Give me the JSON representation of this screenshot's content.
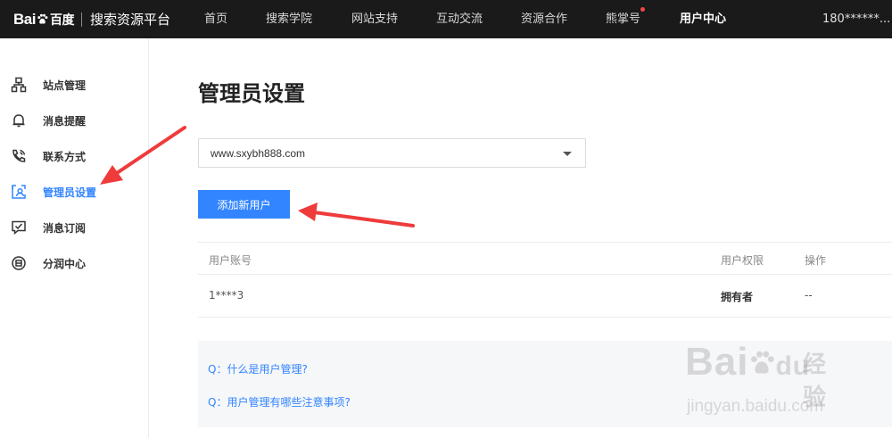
{
  "header": {
    "logo_brand": "Bai",
    "logo_brand_suffix": "百度",
    "platform": "搜索资源平台",
    "nav": [
      {
        "label": "首页"
      },
      {
        "label": "搜索学院"
      },
      {
        "label": "网站支持"
      },
      {
        "label": "互动交流"
      },
      {
        "label": "资源合作"
      },
      {
        "label": "熊掌号"
      },
      {
        "label": "用户中心"
      }
    ],
    "account": "180******..."
  },
  "sidebar": {
    "items": [
      {
        "label": "站点管理",
        "icon": "sitemap-icon"
      },
      {
        "label": "消息提醒",
        "icon": "bell-icon"
      },
      {
        "label": "联系方式",
        "icon": "phone-icon"
      },
      {
        "label": "管理员设置",
        "icon": "admin-user-icon"
      },
      {
        "label": "消息订阅",
        "icon": "subscribe-icon"
      },
      {
        "label": "分润中心",
        "icon": "profit-share-icon"
      }
    ],
    "active_index": 3
  },
  "main": {
    "title": "管理员设置",
    "site_select": {
      "value": "www.sxybh888.com"
    },
    "add_user_label": "添加新用户",
    "table": {
      "headers": [
        "用户账号",
        "用户权限",
        "操作"
      ],
      "rows": [
        [
          "1****3",
          "拥有者",
          "--"
        ]
      ]
    },
    "faq": [
      {
        "text": "Q：什么是用户管理?"
      },
      {
        "text": "Q：用户管理有哪些注意事项?"
      }
    ]
  },
  "watermark": {
    "brand_left": "Bai",
    "brand_right": "du",
    "brand_cn": "经验",
    "url": "jingyan.baidu.com"
  },
  "colors": {
    "accent": "#3385ff",
    "topbar": "#1a1a1a",
    "annotation_arrow": "#ef3b3b",
    "notification_dot": "#f04848"
  }
}
